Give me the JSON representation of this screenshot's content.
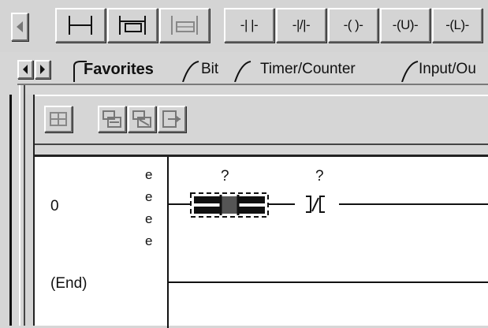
{
  "toolbar": {
    "items": [
      {
        "name": "scroll-left-button",
        "label": ""
      },
      {
        "name": "rung-button",
        "label": ""
      },
      {
        "name": "branch-button",
        "label": ""
      },
      {
        "name": "branch-level-button",
        "label": ""
      },
      {
        "name": "xic-button",
        "label": "-| |-"
      },
      {
        "name": "xio-button",
        "label": "-|/|-"
      },
      {
        "name": "ote-button",
        "label": "-( )-"
      },
      {
        "name": "otu-button",
        "label": "-(U)-"
      },
      {
        "name": "otl-button",
        "label": "-(L)-"
      }
    ]
  },
  "tabs": {
    "items": [
      {
        "label": "Favorites",
        "active": true
      },
      {
        "label": "Bit",
        "active": false
      },
      {
        "label": "Timer/Counter",
        "active": false
      },
      {
        "label": "Input/Ou",
        "active": false
      }
    ]
  },
  "sub_toolbar": {
    "buttons": [
      "start-edit-icon",
      "accept-edits-icon",
      "cancel-edits-icon",
      "finalize-edits-icon"
    ]
  },
  "ladder": {
    "rungs": [
      {
        "number": "0",
        "markers": [
          "e",
          "e",
          "e",
          "e"
        ],
        "instructions": [
          {
            "type": "xic-placeholder",
            "address": "?"
          },
          {
            "type": "xio",
            "address": "?"
          }
        ]
      },
      {
        "number": "(End)"
      }
    ]
  }
}
